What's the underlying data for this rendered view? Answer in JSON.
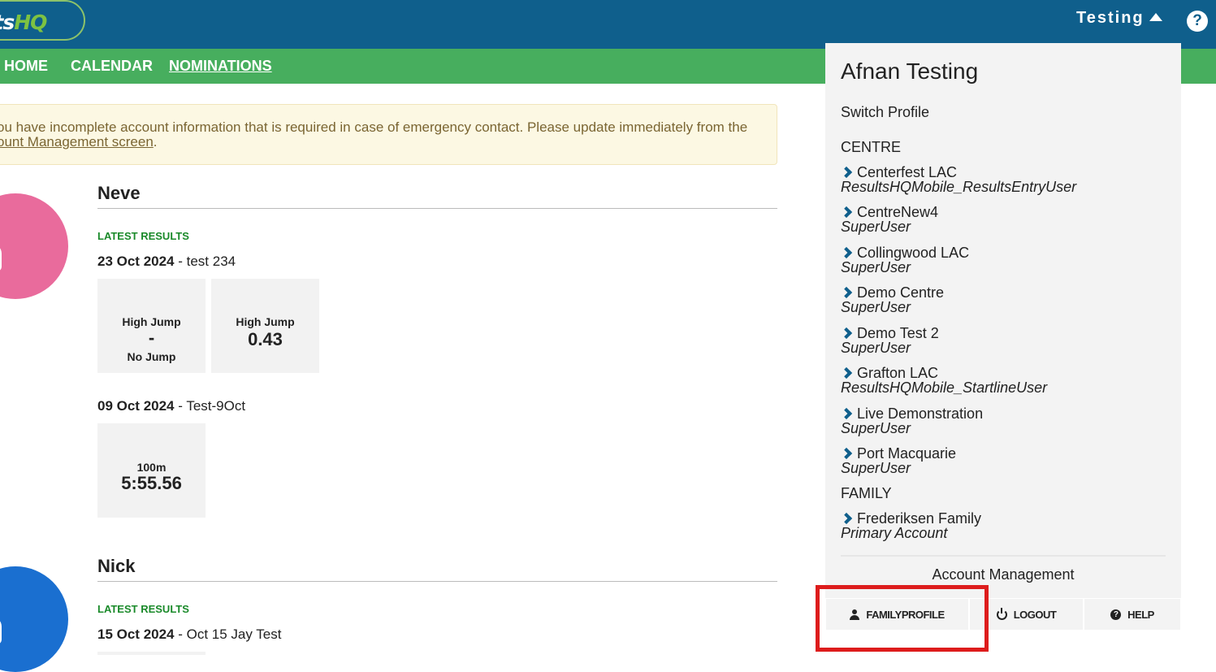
{
  "header": {
    "logo_part1": "ults",
    "logo_part2": "HQ",
    "user_label": "Testing",
    "help_glyph": "?"
  },
  "nav": {
    "items": [
      {
        "label": "HOME"
      },
      {
        "label": "CALENDAR"
      },
      {
        "label": "NOMINATIONS",
        "active": true
      }
    ]
  },
  "alert": {
    "line1": "ou have incomplete account information that is required in case of emergency contact. Please update immediately from the",
    "line2_link": "ount Management screen",
    "line2_end": "."
  },
  "athletes": [
    {
      "name": "Neve",
      "avatar_color": "#e96b9c",
      "latest_label": "LATEST RESULTS",
      "meets": [
        {
          "date": "23 Oct 2024",
          "sep": " - ",
          "name": "test 234",
          "results": [
            {
              "event": "High Jump",
              "value": "-",
              "note": "No Jump"
            },
            {
              "event": "High Jump",
              "value": "0.43",
              "note": ""
            }
          ]
        },
        {
          "date": "09 Oct 2024",
          "sep": " - ",
          "name": "Test-9Oct",
          "results": [
            {
              "event": "100m",
              "value": "5:55.56",
              "note": ""
            }
          ]
        }
      ]
    },
    {
      "name": "Nick",
      "avatar_color": "#1a6fd0",
      "latest_label": "LATEST RESULTS",
      "meets": [
        {
          "date": "15 Oct 2024",
          "sep": " - ",
          "name": "Oct 15 Jay Test"
        }
      ]
    }
  ],
  "dropdown": {
    "user_name": "Afnan Testing",
    "switch_label": "Switch Profile",
    "centre_header": "CENTRE",
    "centres": [
      {
        "org": "Centerfest LAC",
        "role": "ResultsHQMobile_ResultsEntryUser"
      },
      {
        "org": "CentreNew4",
        "role": "SuperUser"
      },
      {
        "org": "Collingwood LAC",
        "role": "SuperUser"
      },
      {
        "org": "Demo Centre",
        "role": "SuperUser"
      },
      {
        "org": "Demo Test 2",
        "role": "SuperUser"
      },
      {
        "org": "Grafton LAC",
        "role": "ResultsHQMobile_StartlineUser"
      },
      {
        "org": "Live Demonstration",
        "role": "SuperUser"
      },
      {
        "org": "Port Macquarie",
        "role": "SuperUser"
      }
    ],
    "family_header": "FAMILY",
    "families": [
      {
        "org": "Frederiksen Family",
        "role": "Primary Account"
      }
    ],
    "account_management": "Account Management",
    "buttons": {
      "family_profile": "FAMILYPROFILE",
      "logout": "LOGOUT",
      "help": "HELP",
      "help_glyph": "?"
    }
  },
  "colors": {
    "header": "#0f5f8c",
    "nav": "#47ae5e",
    "highlight": "#dd1c1c"
  }
}
